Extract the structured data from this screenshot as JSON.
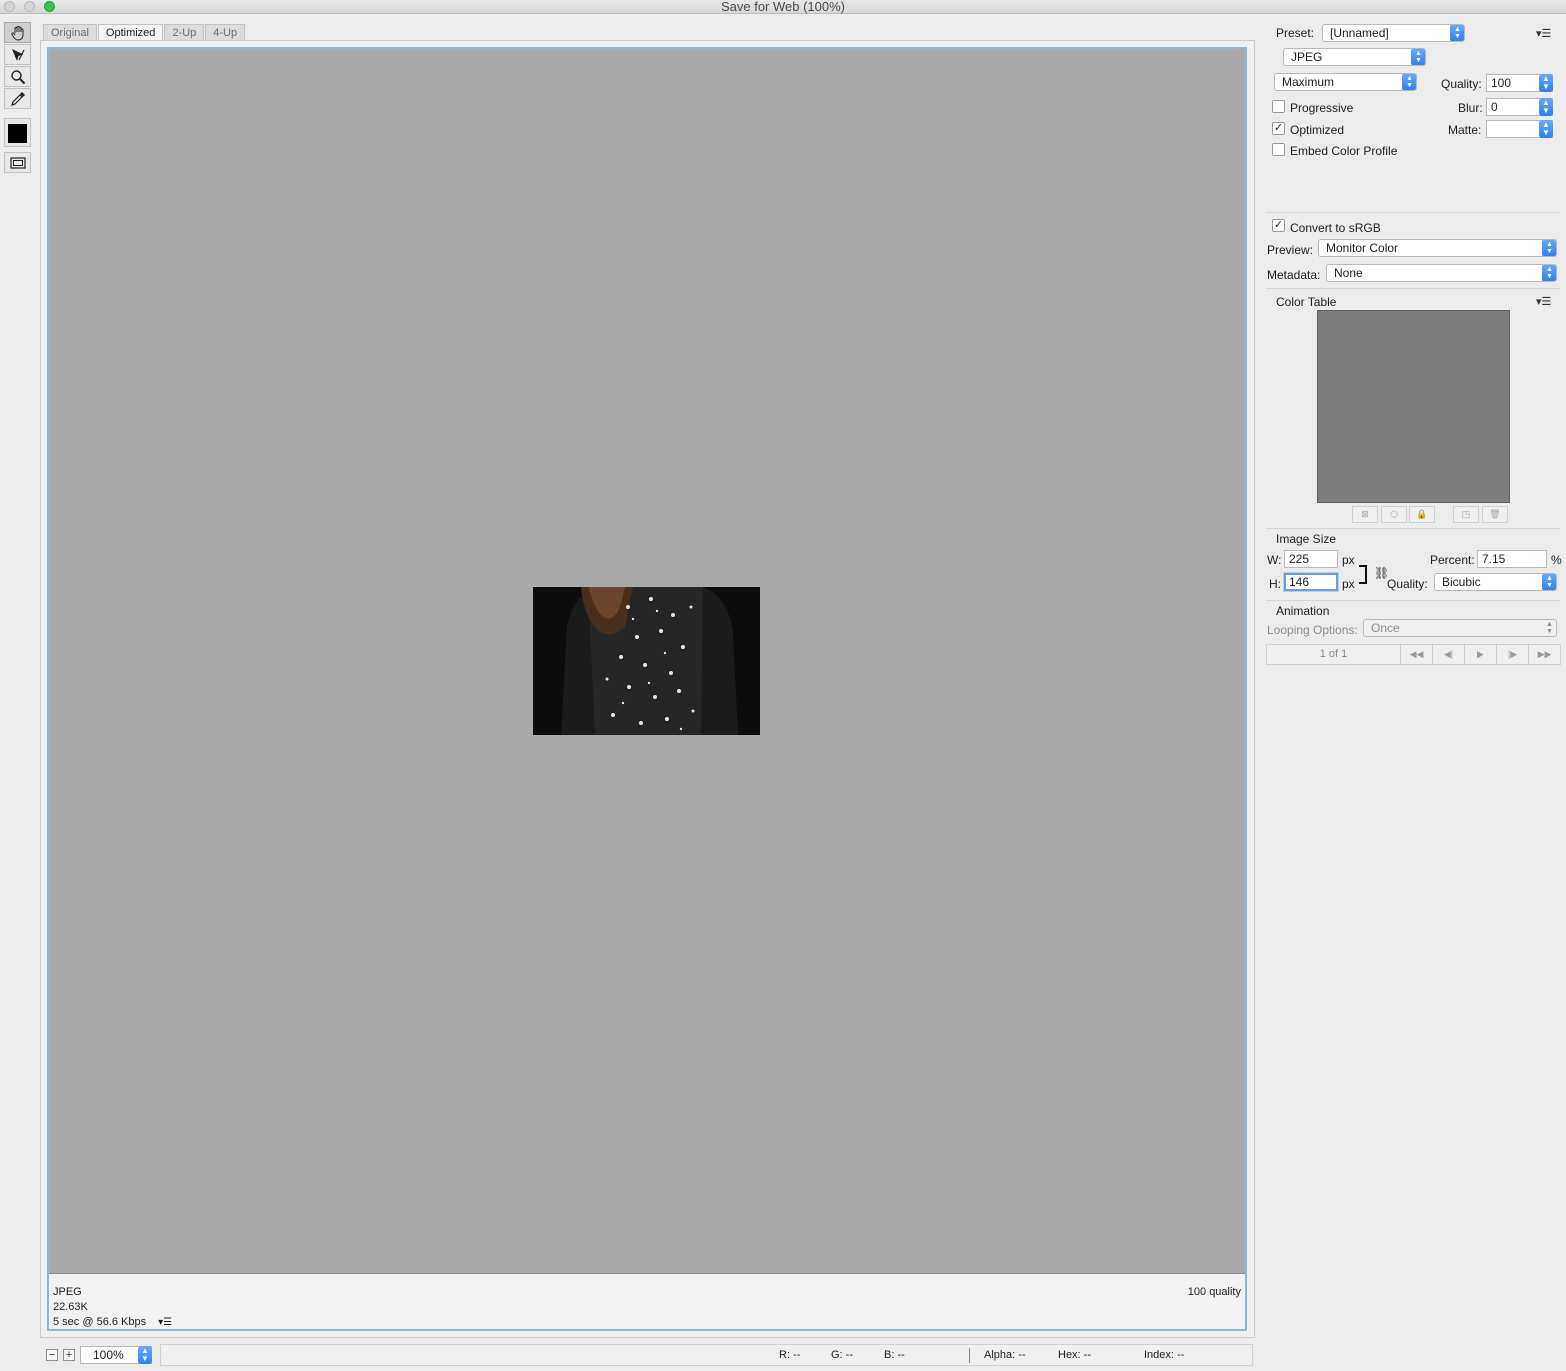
{
  "window": {
    "title": "Save for Web (100%)"
  },
  "tabs": [
    {
      "label": "Original",
      "active": false
    },
    {
      "label": "Optimized",
      "active": true
    },
    {
      "label": "2-Up",
      "active": false
    },
    {
      "label": "4-Up",
      "active": false
    }
  ],
  "tools": [
    "hand-icon",
    "slice-select-icon",
    "zoom-icon",
    "eyedropper-icon",
    "eyedropper-color-swatch",
    "toggle-slices-icon"
  ],
  "canvas": {
    "info_left": {
      "format": "JPEG",
      "size": "22.63K",
      "time": "5 sec @ 56.6 Kbps"
    },
    "info_right": {
      "quality": "100 quality"
    }
  },
  "status": {
    "zoom": "100%",
    "r": "R: --",
    "g": "G: --",
    "b": "B: --",
    "alpha": "Alpha: --",
    "hex": "Hex: --",
    "index": "Index: --"
  },
  "panel": {
    "preset_label": "Preset:",
    "preset_value": "[Unnamed]",
    "format_value": "JPEG",
    "compression_value": "Maximum",
    "quality_label": "Quality:",
    "quality_value": "100",
    "blur_label": "Blur:",
    "blur_value": "0",
    "matte_label": "Matte:",
    "matte_value": "",
    "progressive_label": "Progressive",
    "optimized_label": "Optimized",
    "embed_label": "Embed Color Profile",
    "convert_label": "Convert to sRGB",
    "preview_label": "Preview:",
    "preview_value": "Monitor Color",
    "metadata_label": "Metadata:",
    "metadata_value": "None",
    "color_table_title": "Color Table",
    "image_size_title": "Image Size",
    "w_label": "W:",
    "w_value": "225",
    "h_label": "H:",
    "h_value": "146",
    "px_unit": "px",
    "percent_label": "Percent:",
    "percent_value": "7.15",
    "percent_unit": "%",
    "resample_label": "Quality:",
    "resample_value": "Bicubic",
    "animation_title": "Animation",
    "looping_label": "Looping Options:",
    "looping_value": "Once",
    "frame_counter": "1 of 1"
  },
  "checks": {
    "progressive": false,
    "optimized": true,
    "embed": false,
    "convert": true
  },
  "colors": {
    "accent": "#2b7ff2",
    "canvas_border": "#89b6e3",
    "stage": "#a9a9a9",
    "color_table": "#7d7d7d"
  }
}
